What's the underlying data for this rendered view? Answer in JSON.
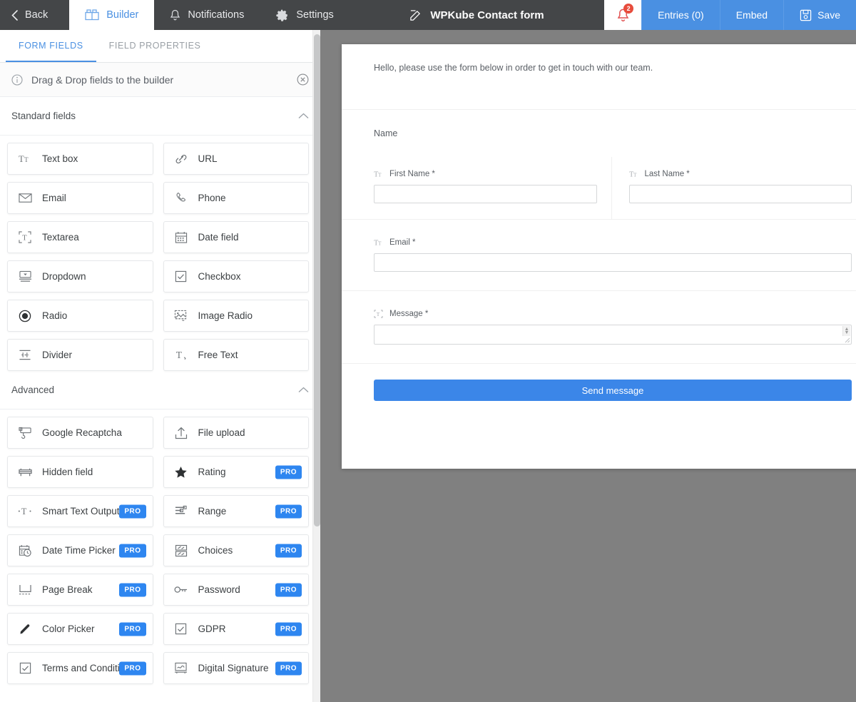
{
  "topbar": {
    "back_label": "Back",
    "tabs": [
      {
        "label": "Builder",
        "icon": "builder-blocks-icon",
        "active": true
      },
      {
        "label": "Notifications",
        "icon": "bell-icon",
        "active": false
      },
      {
        "label": "Settings",
        "icon": "gear-icon",
        "active": false
      }
    ],
    "form_title": "WPKube Contact form",
    "form_title_icon": "pencil-edit-icon",
    "bell_icon": "bell-alert-icon",
    "bell_badge": "2",
    "entries_label": "Entries (0)",
    "embed_label": "Embed",
    "save_label": "Save",
    "save_icon": "floppy-save-icon",
    "accent_blue": "#4a90e2",
    "bar_dark": "#444648",
    "badge_red": "#e74c3c"
  },
  "sidebar": {
    "tabs": [
      {
        "label": "FORM FIELDS",
        "active": true
      },
      {
        "label": "FIELD PROPERTIES",
        "active": false
      }
    ],
    "hint": {
      "text": "Drag & Drop fields to the builder",
      "info_icon": "info-circle-icon",
      "close_icon": "close-circle-icon"
    },
    "sections": [
      {
        "title": "Standard fields",
        "collapse_icon": "chevron-up-icon",
        "fields": [
          {
            "label": "Text box",
            "icon": "text-box-icon",
            "pro": false
          },
          {
            "label": "URL",
            "icon": "link-icon",
            "pro": false
          },
          {
            "label": "Email",
            "icon": "envelope-icon",
            "pro": false
          },
          {
            "label": "Phone",
            "icon": "phone-icon",
            "pro": false
          },
          {
            "label": "Textarea",
            "icon": "textarea-icon",
            "pro": false
          },
          {
            "label": "Date field",
            "icon": "calendar-icon",
            "pro": false
          },
          {
            "label": "Dropdown",
            "icon": "dropdown-icon",
            "pro": false
          },
          {
            "label": "Checkbox",
            "icon": "checkbox-icon",
            "pro": false
          },
          {
            "label": "Radio",
            "icon": "radio-icon",
            "pro": false
          },
          {
            "label": "Image Radio",
            "icon": "image-radio-icon",
            "pro": false
          },
          {
            "label": "Divider",
            "icon": "divider-icon",
            "pro": false
          },
          {
            "label": "Free Text",
            "icon": "free-text-icon",
            "pro": false
          }
        ]
      },
      {
        "title": "Advanced",
        "collapse_icon": "chevron-up-icon",
        "fields": [
          {
            "label": "Google Recaptcha",
            "icon": "recaptcha-icon",
            "pro": false
          },
          {
            "label": "File upload",
            "icon": "upload-icon",
            "pro": false
          },
          {
            "label": "Hidden field",
            "icon": "hidden-field-icon",
            "pro": false
          },
          {
            "label": "Rating",
            "icon": "star-icon",
            "pro": true
          },
          {
            "label": "Smart Text Output",
            "icon": "smart-text-icon",
            "pro": true
          },
          {
            "label": "Range",
            "icon": "range-slider-icon",
            "pro": true
          },
          {
            "label": "Date Time Picker",
            "icon": "date-time-icon",
            "pro": true
          },
          {
            "label": "Choices",
            "icon": "choices-icon",
            "pro": true
          },
          {
            "label": "Page Break",
            "icon": "page-break-icon",
            "pro": true
          },
          {
            "label": "Password",
            "icon": "key-icon",
            "pro": true
          },
          {
            "label": "Color Picker",
            "icon": "pen-color-icon",
            "pro": true
          },
          {
            "label": "GDPR",
            "icon": "checkbox-icon",
            "pro": true
          },
          {
            "label": "Terms and Conditions",
            "icon": "checkbox-icon",
            "pro": true
          },
          {
            "label": "Digital Signature",
            "icon": "signature-icon",
            "pro": true
          }
        ]
      }
    ],
    "pro_badge_label": "PRO",
    "pro_badge_color": "#2e86f0"
  },
  "preview": {
    "background": "#808080",
    "intro_text": "Hello, please use the form below in order to get in touch with our team.",
    "name_group_label": "Name",
    "fields": [
      {
        "label": "First Name *",
        "icon": "text-box-icon",
        "value": "",
        "type": "text"
      },
      {
        "label": "Last Name *",
        "icon": "text-box-icon",
        "value": "",
        "type": "text"
      },
      {
        "label": "Email *",
        "icon": "text-box-icon",
        "value": "",
        "type": "text"
      },
      {
        "label": "Message *",
        "icon": "textarea-icon",
        "value": "",
        "type": "textarea"
      }
    ],
    "submit_label": "Send message",
    "submit_color": "#3b86e8"
  }
}
